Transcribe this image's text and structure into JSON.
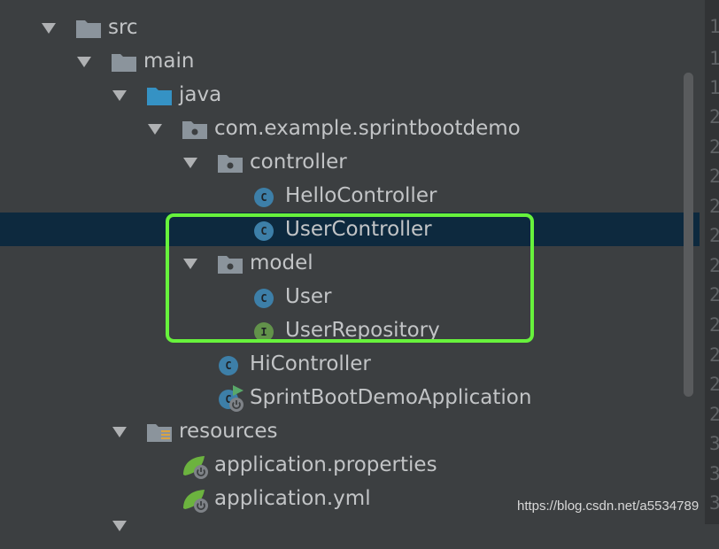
{
  "tree": {
    "src": "src",
    "main": "main",
    "java": "java",
    "package": "com.example.sprintbootdemo",
    "controller": "controller",
    "hello_controller": "HelloController",
    "user_controller": "UserController",
    "model": "model",
    "user": "User",
    "user_repository": "UserRepository",
    "hi_controller": "HiController",
    "application_class": "SprintBootDemoApplication",
    "resources": "resources",
    "application_properties": "application.properties",
    "application_yml": "application.yml"
  },
  "badges": {
    "class": "C",
    "interface": "I"
  },
  "line_numbers": [
    "1",
    "1",
    "1",
    "2",
    "2",
    "2",
    "2",
    "2",
    "2",
    "2",
    "2",
    "2",
    "2",
    "2",
    "3",
    "3",
    "3"
  ],
  "watermark": "https://blog.csdn.net/a5534789",
  "colors": {
    "background": "#3c3f41",
    "selection": "#0d293e",
    "highlight_box": "#67f23c",
    "class_badge": "#3d7fa8",
    "interface_badge": "#62924a",
    "source_folder": "#3592c4",
    "spring_leaf": "#6cb33f"
  }
}
